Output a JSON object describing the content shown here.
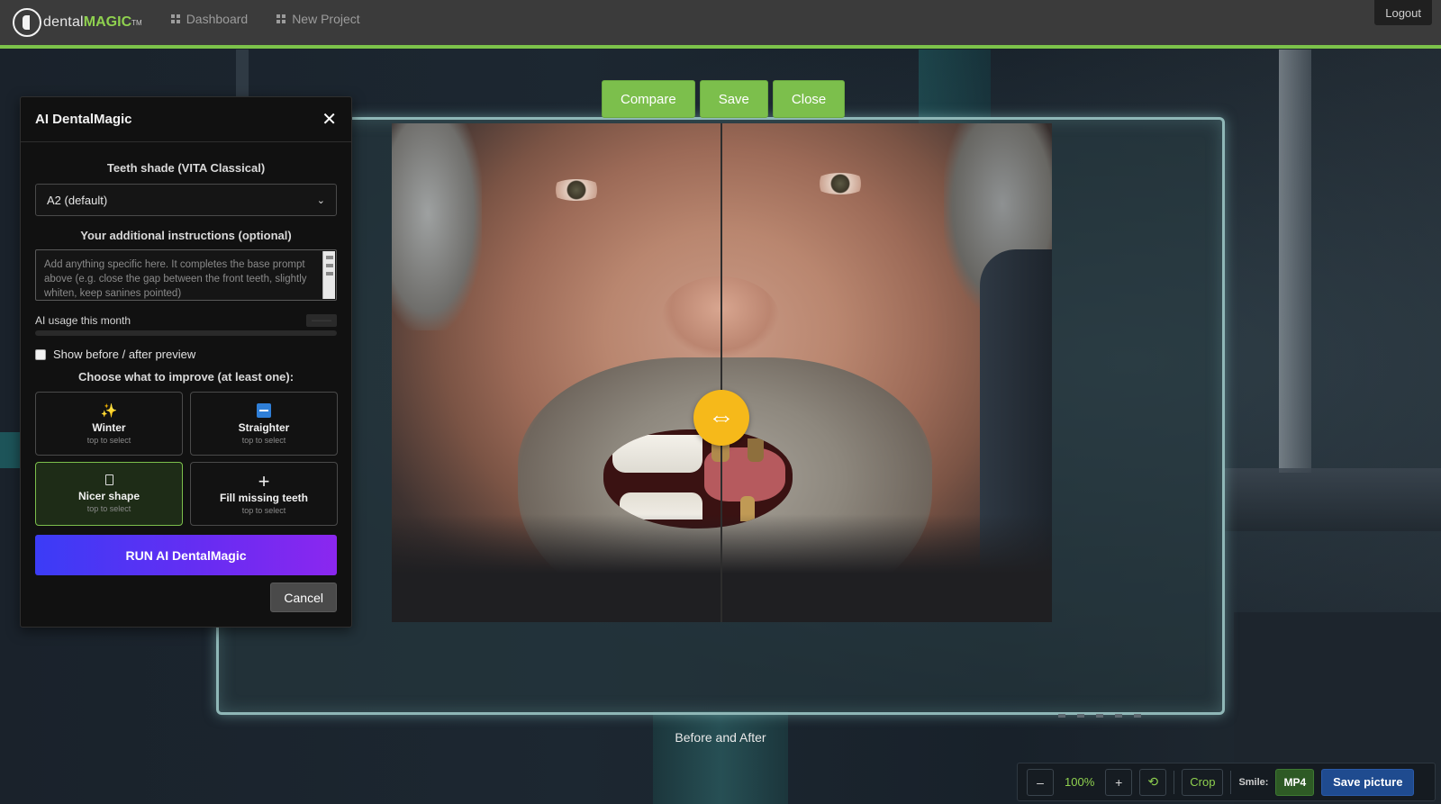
{
  "app": {
    "logo_prefix": "dental",
    "logo_accent": "MAGIC",
    "logo_tm": "TM"
  },
  "nav": [
    {
      "label": "Dashboard"
    },
    {
      "label": "New Project"
    }
  ],
  "header": {
    "logout_label": "Logout"
  },
  "actions": {
    "compare": "Compare",
    "save": "Save",
    "close": "Close"
  },
  "viewer": {
    "caption": "Before and After",
    "slider_glyph": "⇔"
  },
  "panel": {
    "title": "AI DentalMagic",
    "shade_label": "Teeth shade (VITA Classical)",
    "shade_value": "A2 (default)",
    "instructions_label": "Your additional instructions (optional)",
    "instructions_placeholder": "Add anything specific here. It completes the base prompt above (e.g. close the gap between the front teeth, slightly whiten, keep sanines pointed)",
    "usage_label": "AI usage this month",
    "usage_value": "——",
    "preview_label": "Show before / after preview",
    "choose_label": "Choose what to improve (at least one):",
    "options": [
      {
        "title": "Winter",
        "sub": "top to select",
        "icon": "sparkle-icon",
        "selected": false
      },
      {
        "title": "Straighter",
        "sub": "top to select",
        "icon": "straighten-icon",
        "selected": false
      },
      {
        "title": "Nicer shape",
        "sub": "top to select",
        "icon": "tooth-shape-icon",
        "selected": true
      },
      {
        "title": "Fill missing teeth",
        "sub": "top to select",
        "icon": "plus-icon",
        "selected": false
      }
    ],
    "run_label": "RUN AI DentalMagic",
    "cancel_label": "Cancel"
  },
  "toolbar": {
    "zoom_out": "–",
    "zoom_level": "100%",
    "zoom_in": "+",
    "reset_glyph": "⟲",
    "crop": "Crop",
    "smile_label": "Smile:",
    "mp4": "MP4",
    "save_picture": "Save picture"
  },
  "colors": {
    "accent_green": "#7cbf4c",
    "handle": "#f6b91a",
    "run_start": "#3b3cf6",
    "run_end": "#8b27ef",
    "save_blue": "#1f4b8f"
  }
}
